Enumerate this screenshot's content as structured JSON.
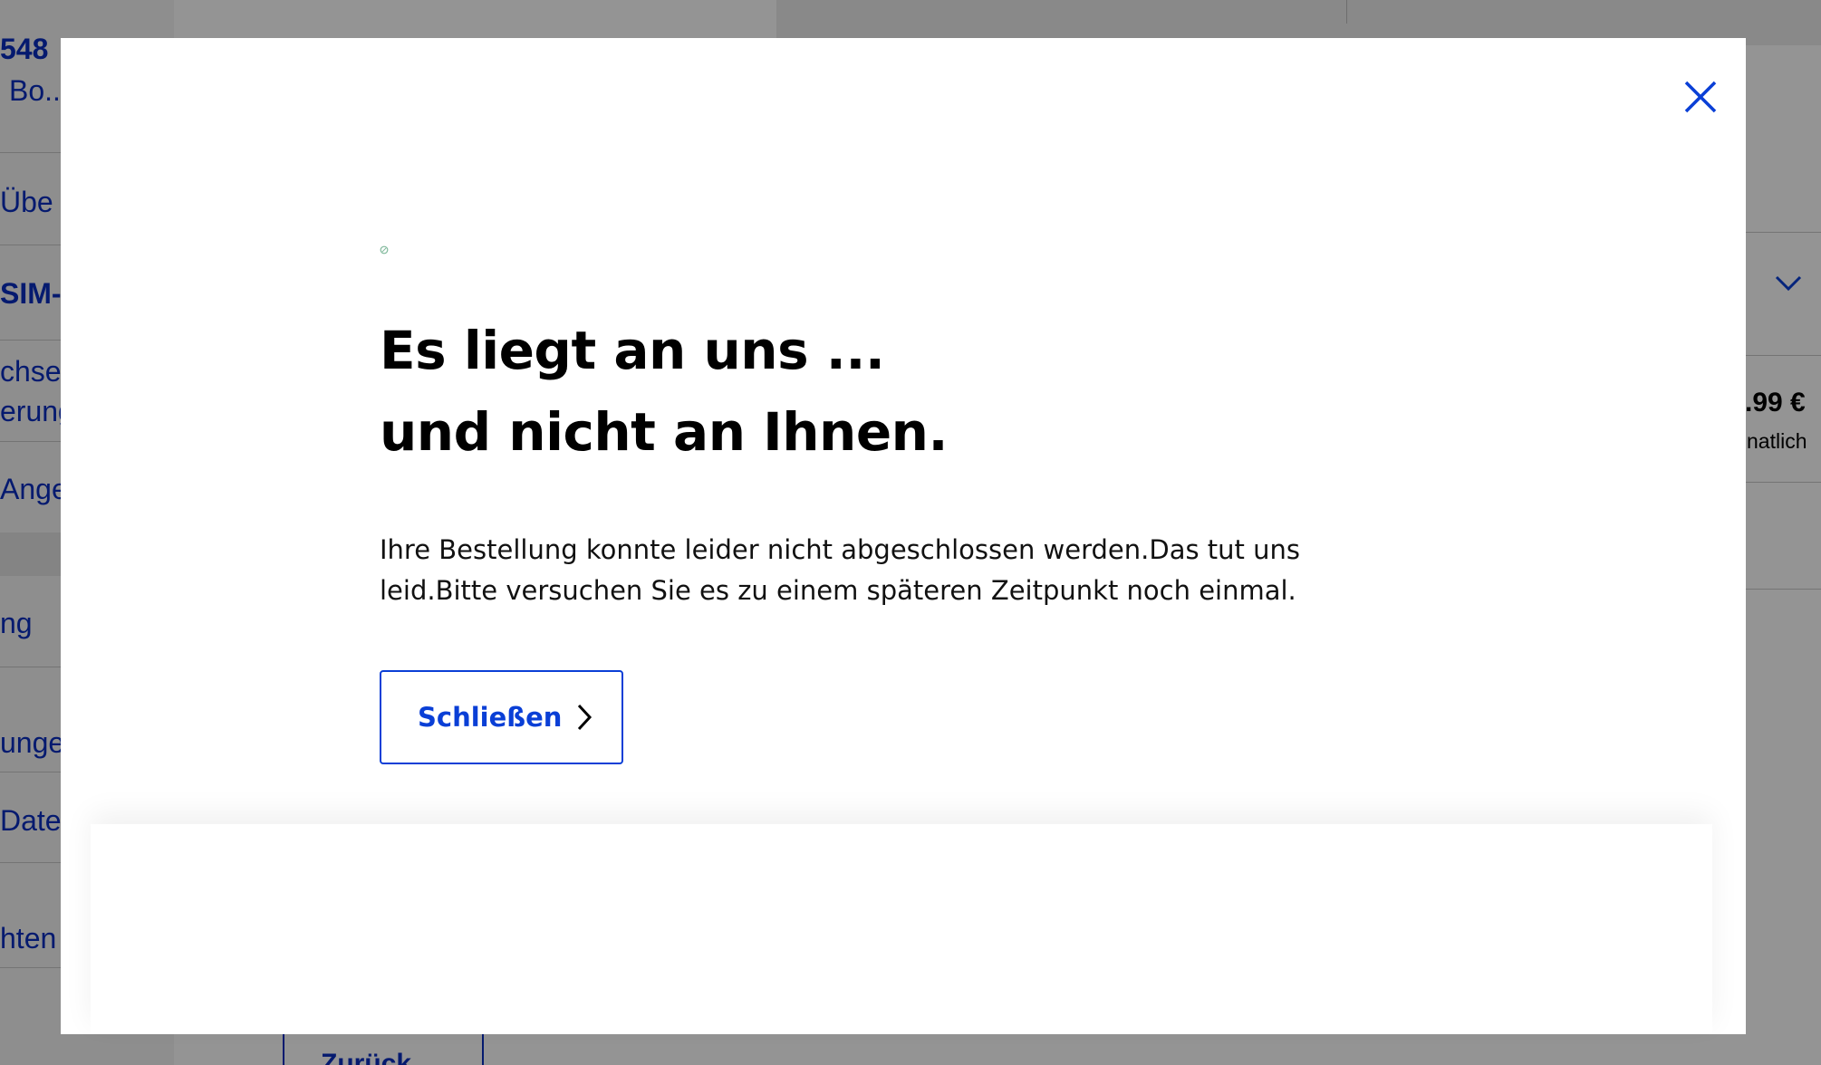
{
  "background": {
    "sidebar": {
      "items": [
        {
          "text": "548"
        },
        {
          "text": "Bo..."
        },
        {
          "text": "Übe"
        },
        {
          "text": "SIM-I"
        },
        {
          "text": "chsel"
        },
        {
          "text": "erung"
        },
        {
          "text": "Angel"
        },
        {
          "text": "ng"
        },
        {
          "text": "unger"
        },
        {
          "text": "Daten"
        },
        {
          "text": "hten"
        }
      ]
    },
    "summary": {
      "price": ".99 €",
      "price_period": "natlich"
    },
    "back_button_label": "Zurück"
  },
  "modal": {
    "headline_line1": "Es liegt an uns ...",
    "headline_line2": "und nicht an Ihnen.",
    "message": "Ihre Bestellung konnte leider nicht abgeschlossen werden.Das tut uns leid.Bitte versuchen Sie es zu einem späteren Zeitpunkt noch einmal.",
    "close_button_label": "Schließen"
  },
  "icons": {
    "close": "close-icon",
    "chevron_right": "chevron-right-icon",
    "chevron_down": "chevron-down-icon"
  },
  "colors": {
    "brand_blue": "#0a3fd6",
    "overlay": "rgba(0,0,0,0.42)"
  }
}
